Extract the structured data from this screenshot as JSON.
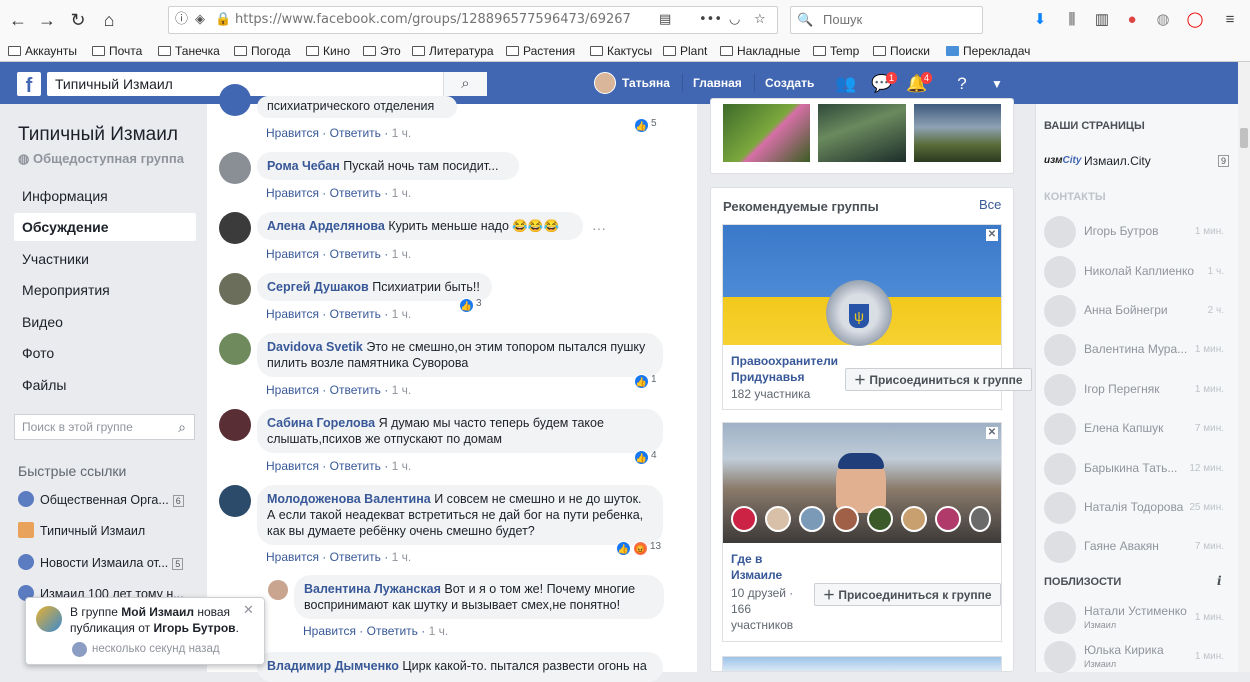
{
  "browser": {
    "url": "https://www.facebook.com/groups/1288965775964​73/6926708",
    "search_placeholder": "Пошук",
    "bookmarks": [
      "Аккаунты",
      "Почта",
      "Танечка",
      "Погода",
      "Кино",
      "Это",
      "Литература",
      "Растения",
      "Кактусы",
      "Plant",
      "Накладные",
      "Temp",
      "Поиски",
      "Перекладач"
    ]
  },
  "fb_header": {
    "logo": "f",
    "search_value": "Типичный Измаил",
    "user_name": "Татьяна",
    "home_label": "Главная",
    "create_label": "Создать",
    "messages_badge": "1",
    "notifications_badge": "4"
  },
  "group": {
    "title": "Типичный Измаил",
    "type": "Общедоступная группа",
    "nav": [
      "Информация",
      "Обсуждение",
      "Участники",
      "Мероприятия",
      "Видео",
      "Фото",
      "Файлы"
    ],
    "active_nav": "Обсуждение",
    "search_placeholder": "Поиск в этой группе",
    "quick_links_header": "Быстрые ссылки",
    "quick_links": [
      {
        "label": "Общественная Орга...",
        "count": "6"
      },
      {
        "label": "Типичный Измаил",
        "count": ""
      },
      {
        "label": "Новости Измаила от...",
        "count": "5"
      },
      {
        "label": "Измаил 100 лет тому н...",
        "count": ""
      }
    ]
  },
  "comments": [
    {
      "name": "",
      "text": "психиатрического отделения",
      "like": "Нравится",
      "reply": "Ответить",
      "time": "1 ч.",
      "reactions": "5"
    },
    {
      "name": "Рома Чебан",
      "text": "Пускай ночь там посидит...",
      "like": "Нравится",
      "reply": "Ответить",
      "time": "1 ч.",
      "reactions": ""
    },
    {
      "name": "Алена Арделянова",
      "text": "Курить меньше надо 😂😂😂",
      "like": "Нравится",
      "reply": "Ответить",
      "time": "1 ч.",
      "reactions": ""
    },
    {
      "name": "Сергей Душаков",
      "text": "Психиатрии быть!!",
      "like": "Нравится",
      "reply": "Ответить",
      "time": "1 ч.",
      "reactions": "3"
    },
    {
      "name": "Davidova Svetik",
      "text": "Это не смешно,он этим топором пытался пушку пилить возле памятника Суворова",
      "like": "Нравится",
      "reply": "Ответить",
      "time": "1 ч.",
      "reactions": "1"
    },
    {
      "name": "Сабина Горелова",
      "text": "Я думаю мы часто теперь будем такое слышать,психов же отпускают по домам",
      "like": "Нравится",
      "reply": "Ответить",
      "time": "1 ч.",
      "reactions": "4"
    },
    {
      "name": "Молодоженова Валентина",
      "text": "И совсем не смешно и не до шуток. А если такой неадекват встретиться не дай бог на пути ребенка, как вы думаете ребёнку очень смешно будет?",
      "like": "Нравится",
      "reply": "Ответить",
      "time": "1 ч.",
      "reactions": "13"
    },
    {
      "name": "Валентина Лужанская",
      "text": "Вот и я о том же! Почему многие воспринимают как шутку и вызывает смех,не понятно!",
      "like": "Нравится",
      "reply": "Ответить",
      "time": "1 ч.",
      "reactions": ""
    },
    {
      "name": "Владимир Дымченко",
      "text": "Цирк какой-то. пытался развести огонь на",
      "like": "",
      "reply": "",
      "time": "",
      "reactions": ""
    }
  ],
  "recommended": {
    "header": "Рекомендуемые группы",
    "all_link": "Все",
    "groups": [
      {
        "name": "Правоохранители Придунавья",
        "members": "182 участника",
        "join": "Присоединиться к группе"
      },
      {
        "name": "Где в Измаиле",
        "members": "10 друзей · 166 участников",
        "friends": "10 друзей ·",
        "count": "166 участников",
        "join": "Присоединиться к группе"
      }
    ]
  },
  "chat": {
    "pages_header": "ВАШИ СТРАНИЦЫ",
    "page_name": "Измаил.City",
    "page_badge": "9",
    "contacts_header": "КОНТАКТЫ",
    "contacts": [
      {
        "name": "Игорь Бутров",
        "time": "1 мин."
      },
      {
        "name": "Николай Каплиенко",
        "time": "1 ч."
      },
      {
        "name": "Анна Бойнегри",
        "time": "2 ч."
      },
      {
        "name": "Валентина Мура...",
        "time": "1 мин."
      },
      {
        "name": "Ігор Перегняк",
        "time": "1 мин."
      },
      {
        "name": "Елена Капшук",
        "time": "7 мин."
      },
      {
        "name": "Барыкина Тать...",
        "time": "12 мин."
      },
      {
        "name": "Наталія Тодорова",
        "time": "25 мин."
      },
      {
        "name": "Гаяне Авакян",
        "time": "7 мин."
      }
    ],
    "nearby_header": "ПОБЛИЗОСТИ",
    "nearby": [
      {
        "name": "Натали Устименко",
        "sub": "Измаил",
        "time": "1 мин."
      },
      {
        "name": "Юлька Кирика",
        "sub": "Измаил",
        "time": "1 мин."
      }
    ]
  },
  "notification": {
    "part1": "В группе ",
    "group": "Мой Измаил",
    "part2": " новая публикация от ",
    "author": "Игорь Бутров",
    "part3": ".",
    "time": "несколько секунд назад"
  }
}
